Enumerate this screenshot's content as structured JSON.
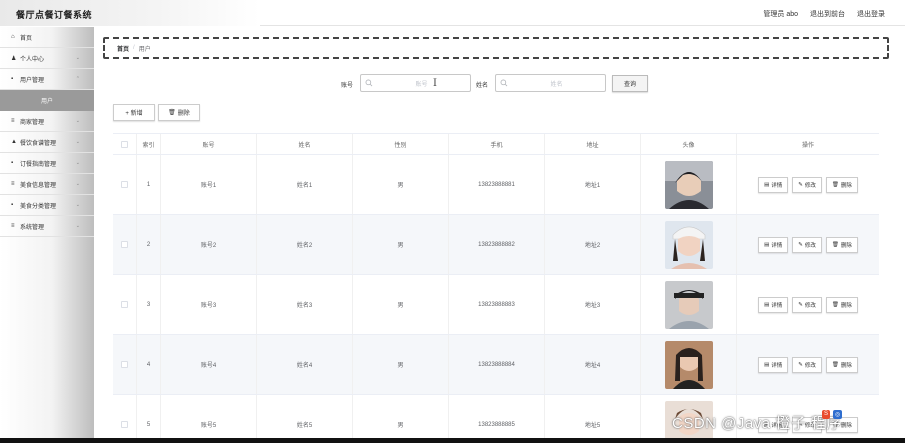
{
  "app": {
    "title": "餐厅点餐订餐系统"
  },
  "header": {
    "user": "管理员 abo",
    "to_front": "退出到前台",
    "logout": "退出登录"
  },
  "sidebar": {
    "items": [
      {
        "label": "首页",
        "icon": "home-icon",
        "glyph": "⌂"
      },
      {
        "label": "个人中心",
        "icon": "user-icon",
        "glyph": "♟"
      },
      {
        "label": "用户管理",
        "icon": "grid-icon",
        "glyph": "▪"
      },
      {
        "label": "用户",
        "active": true
      },
      {
        "label": "商家管理",
        "icon": "sliders-icon",
        "glyph": "≡"
      },
      {
        "label": "餐饮食谱管理",
        "icon": "thumb-icon",
        "glyph": "▲"
      },
      {
        "label": "订餐指南管理",
        "icon": "grid-icon",
        "glyph": "▪"
      },
      {
        "label": "美食信息管理",
        "icon": "list-icon",
        "glyph": "≡"
      },
      {
        "label": "美食分类管理",
        "icon": "grid-icon",
        "glyph": "▪"
      },
      {
        "label": "系统管理",
        "icon": "menu-icon",
        "glyph": "≡"
      }
    ]
  },
  "breadcrumb": {
    "home": "首页",
    "sep": "/",
    "current": "用户"
  },
  "search": {
    "account_label": "账号",
    "account_placeholder": "账号",
    "name_label": "姓名",
    "name_placeholder": "姓名",
    "query_button": "查询"
  },
  "actions": {
    "add": "+ 新增",
    "delete": "删除"
  },
  "table": {
    "headers": [
      "索引",
      "账号",
      "姓名",
      "性别",
      "手机",
      "地址",
      "头像",
      "操作"
    ],
    "rows": [
      {
        "index": "1",
        "account": "账号1",
        "name": "姓名1",
        "sex": "男",
        "phone": "13823888881",
        "address": "地址1"
      },
      {
        "index": "2",
        "account": "账号2",
        "name": "姓名2",
        "sex": "男",
        "phone": "13823888882",
        "address": "地址2"
      },
      {
        "index": "3",
        "account": "账号3",
        "name": "姓名3",
        "sex": "男",
        "phone": "13823888883",
        "address": "地址3"
      },
      {
        "index": "4",
        "account": "账号4",
        "name": "姓名4",
        "sex": "男",
        "phone": "13823888884",
        "address": "地址4"
      },
      {
        "index": "5",
        "account": "账号5",
        "name": "姓名5",
        "sex": "男",
        "phone": "13823888885",
        "address": "地址5"
      }
    ],
    "row_actions": {
      "detail": "详情",
      "edit": "修改",
      "delete": "删除"
    }
  },
  "watermark": "CSDN @Java 橙子 程序"
}
